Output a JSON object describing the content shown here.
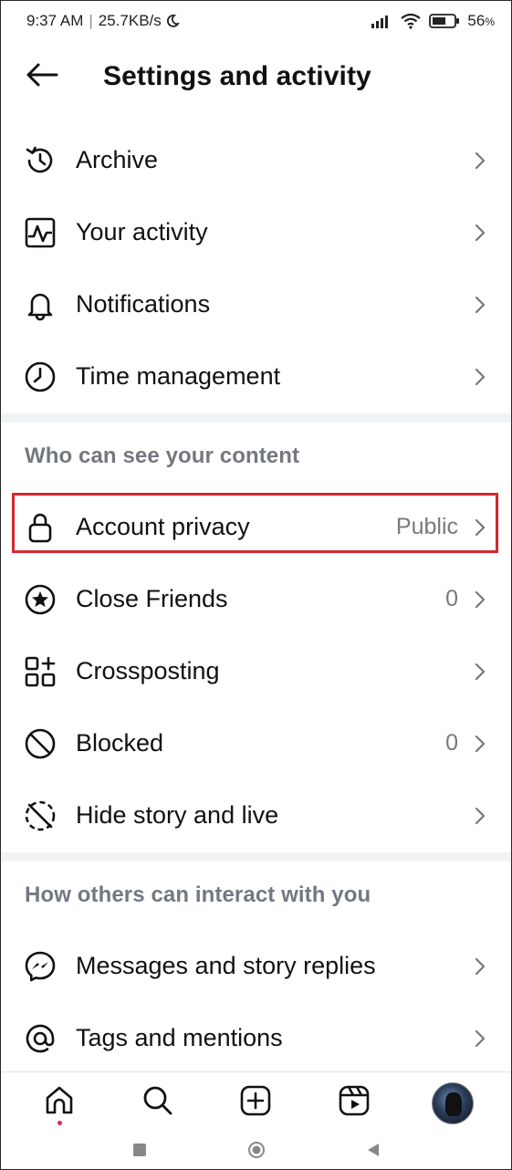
{
  "status_bar": {
    "time": "9:37 AM",
    "network_speed": "25.7KB/s",
    "battery": "56"
  },
  "header": {
    "title": "Settings and activity",
    "back_icon": "arrow-left-icon"
  },
  "top_items": [
    {
      "label": "Archive",
      "icon": "archive-history-icon"
    },
    {
      "label": "Your activity",
      "icon": "activity-chart-icon"
    },
    {
      "label": "Notifications",
      "icon": "bell-icon"
    },
    {
      "label": "Time management",
      "icon": "clock-icon"
    }
  ],
  "sections": [
    {
      "title": "Who can see your content",
      "items": [
        {
          "label": "Account privacy",
          "value": "Public",
          "icon": "lock-icon",
          "highlighted": true
        },
        {
          "label": "Close Friends",
          "value": "0",
          "icon": "star-circle-icon"
        },
        {
          "label": "Crossposting",
          "value": "",
          "icon": "crosspost-grid-icon"
        },
        {
          "label": "Blocked",
          "value": "0",
          "icon": "blocked-icon"
        },
        {
          "label": "Hide story and live",
          "value": "",
          "icon": "hide-story-icon"
        }
      ]
    },
    {
      "title": "How others can interact with you",
      "items": [
        {
          "label": "Messages and story replies",
          "value": "",
          "icon": "messenger-icon"
        },
        {
          "label": "Tags and mentions",
          "value": "",
          "icon": "at-sign-icon"
        }
      ]
    }
  ],
  "bottom_nav": [
    {
      "name": "home",
      "icon": "home-icon",
      "active": true
    },
    {
      "name": "search",
      "icon": "search-icon"
    },
    {
      "name": "create",
      "icon": "plus-square-icon"
    },
    {
      "name": "reels",
      "icon": "reels-icon"
    },
    {
      "name": "profile",
      "icon": "avatar"
    }
  ],
  "accent_color": "#d7282f"
}
